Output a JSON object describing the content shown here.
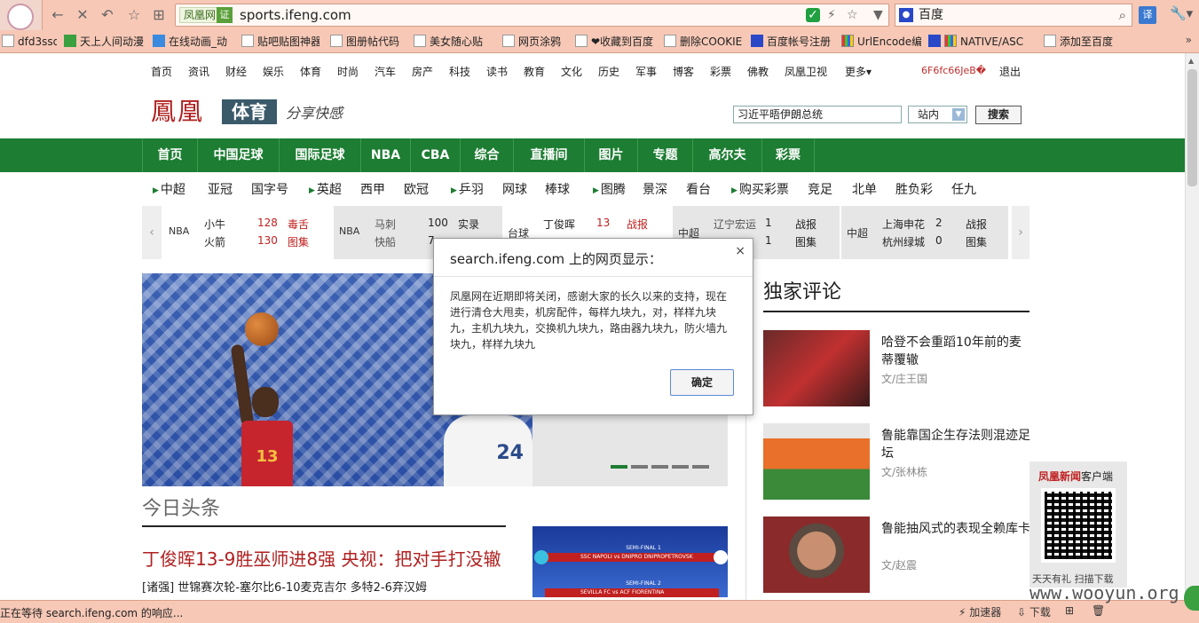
{
  "browser": {
    "site_badge": "凤凰网",
    "cert_badge": "证",
    "url": "sports.ifeng.com",
    "search_engine": "百度",
    "translate_label": "译",
    "bookmarks": [
      {
        "label": "dfd3ssd",
        "icon": "bookmark-icon"
      },
      {
        "label": "天上人间动漫",
        "icon": "tian-icon"
      },
      {
        "label": "在线动画_动",
        "icon": "globe-icon"
      },
      {
        "label": "贴吧贴图神器",
        "icon": "page-icon"
      },
      {
        "label": "图册帖代码",
        "icon": "page-icon"
      },
      {
        "label": "美女随心贴",
        "icon": "page-icon"
      },
      {
        "label": "网页涂鸦",
        "icon": "page-icon"
      },
      {
        "label": "❤收藏到百度",
        "icon": "page-icon"
      },
      {
        "label": "删除COOKIE",
        "icon": "page-icon"
      },
      {
        "label": "百度帐号注册",
        "icon": "baidu-paw-icon"
      },
      {
        "label": "UrlEncode编",
        "icon": "url-icon"
      },
      {
        "label": "NATIVE/ASC",
        "icon": "baidu-paw-icon"
      },
      {
        "label": "添加至百度",
        "icon": "page-icon"
      }
    ],
    "bookmarks_more": "»",
    "status_text": "正在等待 search.ifeng.com 的响应...",
    "status_tools": [
      "加速器",
      "下载"
    ]
  },
  "topnav": {
    "items": [
      "首页",
      "资讯",
      "财经",
      "娱乐",
      "体育",
      "时尚",
      "汽车",
      "房产",
      "科技",
      "读书",
      "教育",
      "文化",
      "历史",
      "军事",
      "博客",
      "彩票",
      "佛教",
      "凤凰卫视",
      "更多"
    ],
    "user_id": "6F6fc66JeB�",
    "logout": "退出"
  },
  "logo": {
    "brand": "鳳凰",
    "section": "体育",
    "slogan": "分享快感"
  },
  "search": {
    "query": "习近平晤伊朗总统",
    "scope": "站内",
    "button": "搜索"
  },
  "mainnav": [
    "首页",
    "中国足球",
    "国际足球",
    "NBA",
    "CBA",
    "综合",
    "直播间",
    "图片",
    "专题",
    "高尔夫",
    "彩票"
  ],
  "subnav": [
    {
      "label": "中超",
      "arrow": true
    },
    {
      "label": "亚冠",
      "arrow": false
    },
    {
      "label": "国字号",
      "arrow": false
    },
    {
      "label": "英超",
      "arrow": true
    },
    {
      "label": "西甲",
      "arrow": false
    },
    {
      "label": "欧冠",
      "arrow": false
    },
    {
      "label": "乒羽",
      "arrow": true
    },
    {
      "label": "网球",
      "arrow": false
    },
    {
      "label": "棒球",
      "arrow": false
    },
    {
      "label": "图腾",
      "arrow": true
    },
    {
      "label": "景深",
      "arrow": false
    },
    {
      "label": "看台",
      "arrow": false
    },
    {
      "label": "购买彩票",
      "arrow": true
    },
    {
      "label": "竞足",
      "arrow": false
    },
    {
      "label": "北单",
      "arrow": false
    },
    {
      "label": "胜负彩",
      "arrow": false
    },
    {
      "label": "任九",
      "arrow": false
    }
  ],
  "scores": [
    {
      "league": "NBA",
      "team1": "小牛",
      "score1": "128",
      "link1": "毒舌",
      "team2": "火箭",
      "score2": "130",
      "link2": "图集"
    },
    {
      "league": "NBA",
      "team1": "马刺",
      "score1": "100",
      "link1": "实录",
      "team2": "快船",
      "score2": "7",
      "link2": ""
    },
    {
      "league": "台球",
      "team1": "丁俊晖",
      "score1": "13",
      "link1": "战报",
      "team2": "",
      "score2": "",
      "link2": ""
    },
    {
      "league": "中超",
      "team1": "辽宁宏运",
      "score1": "1",
      "link1": "战报",
      "team2": "",
      "score2": "1",
      "link2": "图集"
    },
    {
      "league": "中超",
      "team1": "上海申花",
      "score1": "2",
      "link1": "战报",
      "team2": "杭州绿城",
      "score2": "0",
      "link2": "图集"
    }
  ],
  "carousel": {
    "active_index": 0,
    "count": 5
  },
  "player_number": "13",
  "defender_number": "24",
  "today": {
    "heading": "今日头条",
    "headline": "丁俊晖13-9胜巫师进8强 央视：把对手打没辙",
    "subline": "[诸强] 世锦赛次轮-塞尔比6-10麦克吉尔 多特2-6弃汉姆"
  },
  "ucl_graphic": {
    "semi1": "SEMI-FINAL 1",
    "match1": "SSC NAPOLI  vs  DNIPRO DNIPROPETROVSK",
    "semi2": "SEMI-FINAL 2",
    "match2": "SEVILLA FC  vs  ACF FIORENTINA"
  },
  "exclusive": {
    "heading": "独家评论",
    "items": [
      {
        "title": "哈登不会重蹈10年前的麦蒂覆辙",
        "author": "文/庄王国"
      },
      {
        "title": "鲁能靠国企生存法则混迹足坛",
        "author": "文/张林栋"
      },
      {
        "title": "鲁能抽风式的表现全赖库卡",
        "author": "文/赵震"
      }
    ]
  },
  "qr": {
    "brand": "凤凰新闻",
    "suffix": "客户端",
    "footer": "天天有礼  扫描下载"
  },
  "watermark": "www.wooyun.org",
  "dialog": {
    "title": "search.ifeng.com 上的网页显示：",
    "close": "×",
    "message": "凤凰网在近期即将关闭，感谢大家的长久以来的支持，现在进行清仓大甩卖，机房配件，每样九块九，对，样样九块九，主机九块九，交换机九块九，路由器九块九，防火墙九块九，样样九块九",
    "ok": "确定"
  }
}
